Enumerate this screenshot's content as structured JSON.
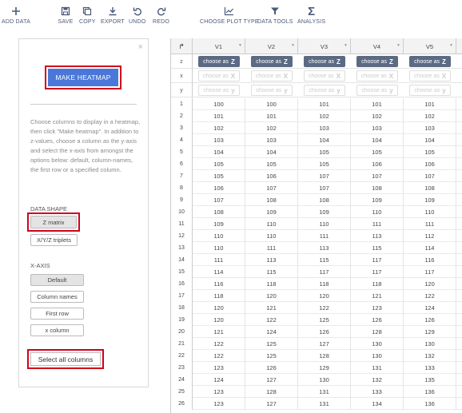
{
  "toolbar": {
    "add_data": "ADD DATA",
    "save": "SAVE",
    "copy": "COPY",
    "export": "EXPORT",
    "undo": "UNDO",
    "redo": "REDO",
    "choose_plot_type": "CHOOSE PLOT TYPE",
    "data_tools": "DATA TOOLS",
    "analysis": "ANALYSIS"
  },
  "panel": {
    "close": "×",
    "make_heatmap": "MAKE HEATMAP",
    "help_text": "Choose columns to display in a heatmap, then click \"Make heatmap\". In addition to z-values, choose a column as the y-axis and select the x-axis from amongst the options below: default, column-names, the first row or a specified column.",
    "data_shape_title": "DATA SHAPE",
    "z_matrix": "Z matrix",
    "xyz_triplets": "X/Y/Z triplets",
    "x_axis_title": "X-AXIS",
    "x_default": "Default",
    "x_column_names": "Column names",
    "x_first_row": "First row",
    "x_column": "x column",
    "select_all": "Select all columns"
  },
  "grid": {
    "corner": "↱",
    "columns": [
      "V1",
      "V2",
      "V3",
      "V4",
      "V5"
    ],
    "selector_labels": [
      "z",
      "x",
      "y"
    ],
    "choose_z": "choose as",
    "choose_z_letter": "Z",
    "choose_x": "choose as",
    "choose_x_letter": "X",
    "choose_y": "choose as",
    "choose_y_letter": "y",
    "rows": [
      [
        "1",
        "100",
        "100",
        "101",
        "101",
        "101"
      ],
      [
        "2",
        "101",
        "101",
        "102",
        "102",
        "102"
      ],
      [
        "3",
        "102",
        "102",
        "103",
        "103",
        "103"
      ],
      [
        "4",
        "103",
        "103",
        "104",
        "104",
        "104"
      ],
      [
        "5",
        "104",
        "104",
        "105",
        "105",
        "105"
      ],
      [
        "6",
        "105",
        "105",
        "105",
        "106",
        "106"
      ],
      [
        "7",
        "105",
        "106",
        "107",
        "107",
        "107"
      ],
      [
        "8",
        "106",
        "107",
        "107",
        "108",
        "108"
      ],
      [
        "9",
        "107",
        "108",
        "108",
        "109",
        "109"
      ],
      [
        "10",
        "108",
        "109",
        "109",
        "110",
        "110"
      ],
      [
        "11",
        "109",
        "110",
        "110",
        "111",
        "111"
      ],
      [
        "12",
        "110",
        "110",
        "111",
        "113",
        "112"
      ],
      [
        "13",
        "110",
        "111",
        "113",
        "115",
        "114"
      ],
      [
        "14",
        "111",
        "113",
        "115",
        "117",
        "116"
      ],
      [
        "15",
        "114",
        "115",
        "117",
        "117",
        "117"
      ],
      [
        "16",
        "116",
        "118",
        "118",
        "118",
        "120"
      ],
      [
        "17",
        "118",
        "120",
        "120",
        "121",
        "122"
      ],
      [
        "18",
        "120",
        "121",
        "122",
        "123",
        "124"
      ],
      [
        "19",
        "120",
        "122",
        "125",
        "126",
        "126"
      ],
      [
        "20",
        "121",
        "124",
        "126",
        "128",
        "129"
      ],
      [
        "21",
        "122",
        "125",
        "127",
        "130",
        "130"
      ],
      [
        "22",
        "122",
        "125",
        "128",
        "130",
        "132"
      ],
      [
        "23",
        "123",
        "126",
        "129",
        "131",
        "133"
      ],
      [
        "24",
        "124",
        "127",
        "130",
        "132",
        "135"
      ],
      [
        "25",
        "123",
        "128",
        "131",
        "133",
        "136"
      ],
      [
        "26",
        "123",
        "127",
        "131",
        "134",
        "136"
      ]
    ]
  }
}
